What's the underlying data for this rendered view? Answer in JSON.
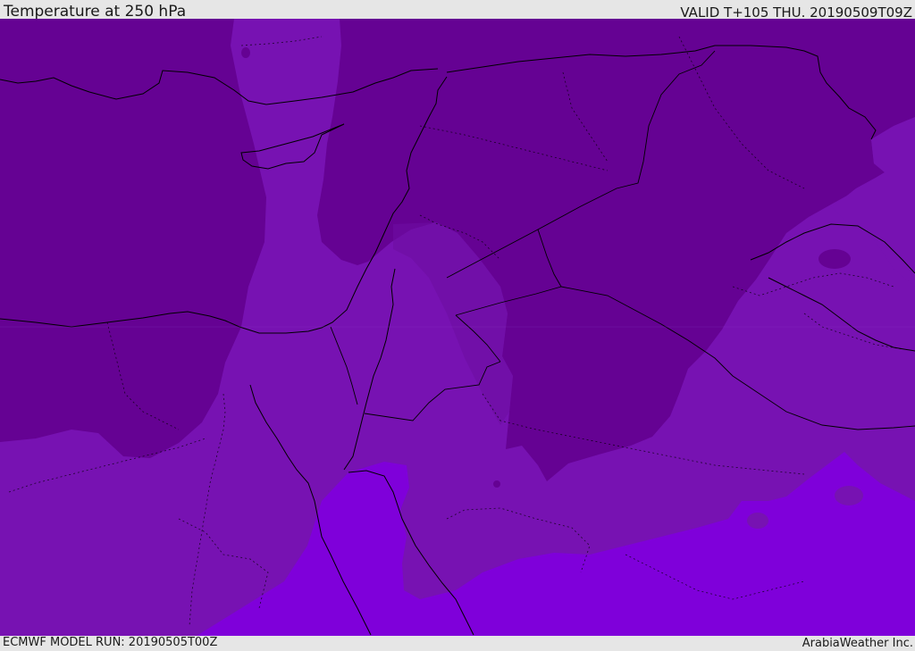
{
  "header": {
    "title": "Temperature at 250 hPa",
    "valid_time": "VALID T+105 THU. 20190509T09Z"
  },
  "footer": {
    "model_run": "ECMWF MODEL RUN: 20190505T00Z",
    "credit": "ArabiaWeather Inc."
  },
  "map": {
    "variable": "temperature",
    "level": "250 hPa",
    "palette": {
      "darkest": "#650293",
      "dark": "#6e0da1",
      "medium": "#7712b2",
      "light": "#7f00da"
    },
    "border_color": "#000000"
  }
}
